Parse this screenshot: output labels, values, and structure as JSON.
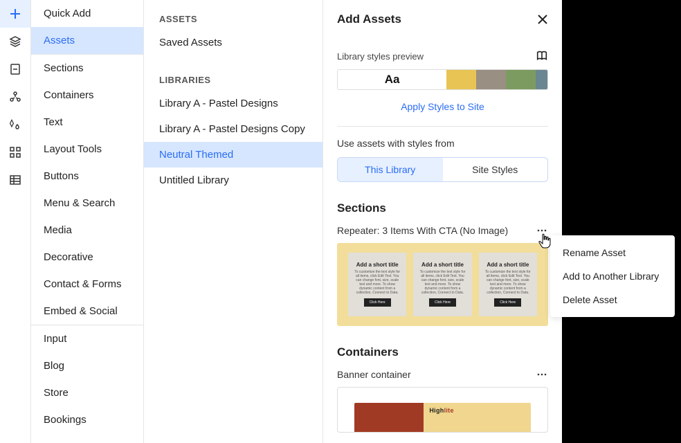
{
  "categories": {
    "items": [
      {
        "label": "Quick Add"
      },
      {
        "label": "Assets"
      },
      {
        "label": "Sections"
      },
      {
        "label": "Containers"
      },
      {
        "label": "Text"
      },
      {
        "label": "Layout Tools"
      },
      {
        "label": "Buttons"
      },
      {
        "label": "Menu & Search"
      },
      {
        "label": "Media"
      },
      {
        "label": "Decorative"
      },
      {
        "label": "Contact & Forms"
      },
      {
        "label": "Embed & Social"
      },
      {
        "label": "Input"
      },
      {
        "label": "Blog"
      },
      {
        "label": "Store"
      },
      {
        "label": "Bookings"
      }
    ]
  },
  "libpanel": {
    "assets_header": "ASSETS",
    "saved_assets": "Saved Assets",
    "libraries_header": "LIBRARIES",
    "libraries": [
      {
        "label": "Library A - Pastel Designs"
      },
      {
        "label": "Library A - Pastel Designs Copy"
      },
      {
        "label": "Neutral Themed"
      },
      {
        "label": "Untitled Library"
      }
    ]
  },
  "addassets": {
    "title": "Add Assets",
    "library_styles_preview": "Library styles preview",
    "aa_glyph": "Aa",
    "apply_styles": "Apply Styles to Site",
    "use_from": "Use assets with styles from",
    "tab_this": "This Library",
    "tab_site": "Site Styles",
    "sections_head": "Sections",
    "asset1_label": "Repeater: 3 Items With CTA (No Image)",
    "containers_head": "Containers",
    "asset2_label": "Banner container",
    "repcard": {
      "title": "Add a short title",
      "body": "To customize the text style for all items, click Edit Text. You can change font, size, scale text and more. To show dynamic content from a collection, Connect to Data.",
      "btn": "Click Here"
    },
    "banner_logo_a": "High",
    "banner_logo_b": "lite"
  },
  "ctxmenu": {
    "rename": "Rename Asset",
    "add": "Add to Another Library",
    "del": "Delete Asset"
  },
  "colors": {
    "swatches": [
      "#e8c455",
      "#998f83",
      "#7c9b60",
      "#688793"
    ]
  }
}
